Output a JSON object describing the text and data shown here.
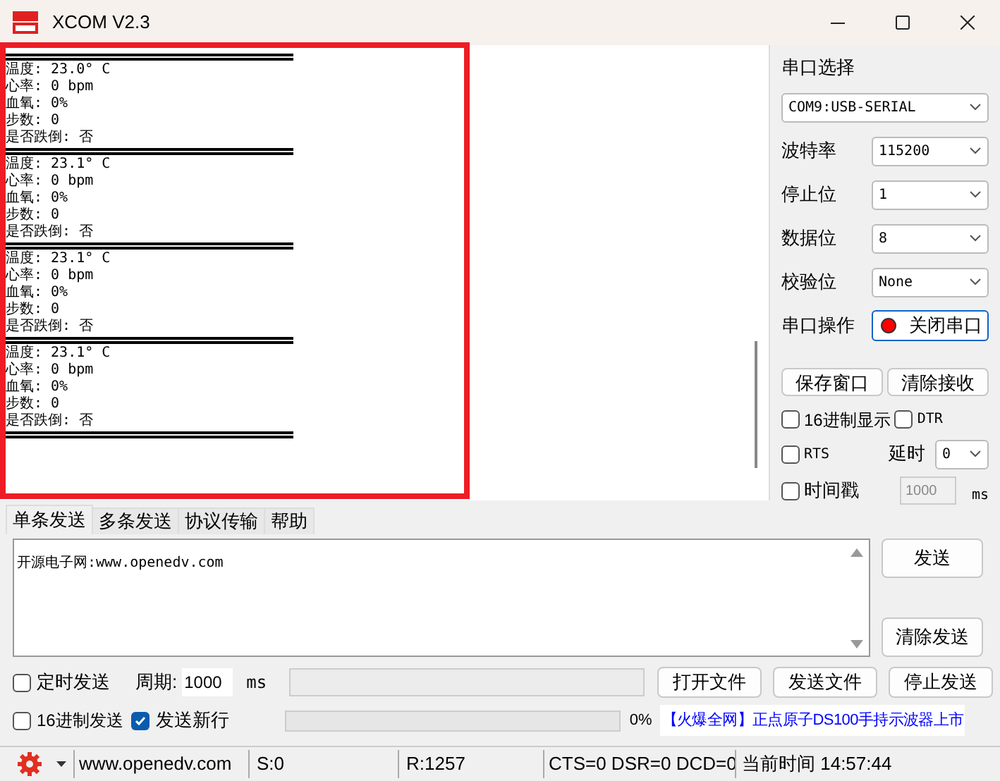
{
  "window": {
    "title": "XCOM V2.3"
  },
  "receive": {
    "records": [
      {
        "lines": [
          "温度: 23.0° C",
          "心率: 0 bpm",
          "血氧: 0%",
          "步数: 0",
          "是否跌倒: 否"
        ]
      },
      {
        "lines": [
          "温度: 23.1° C",
          "心率: 0 bpm",
          "血氧: 0%",
          "步数: 0",
          "是否跌倒: 否"
        ]
      },
      {
        "lines": [
          "温度: 23.1° C",
          "心率: 0 bpm",
          "血氧: 0%",
          "步数: 0",
          "是否跌倒: 否"
        ]
      },
      {
        "lines": [
          "温度: 23.1° C",
          "心率: 0 bpm",
          "血氧: 0%",
          "步数: 0",
          "是否跌倒: 否"
        ]
      }
    ]
  },
  "port_panel": {
    "title": "串口选择",
    "port": "COM9:USB-SERIAL",
    "settings": [
      {
        "label": "波特率",
        "value": "115200"
      },
      {
        "label": "停止位",
        "value": "1"
      },
      {
        "label": "数据位",
        "value": "8"
      },
      {
        "label": "校验位",
        "value": "None"
      }
    ],
    "operation": {
      "label": "串口操作",
      "button": "关闭串口",
      "open": true
    },
    "buttons": [
      "保存窗口",
      "清除接收"
    ],
    "hex_display": {
      "label": "16进制显示",
      "checked": false
    },
    "dtr": {
      "label": "DTR",
      "checked": false
    },
    "rts": {
      "label": "RTS",
      "checked": false
    },
    "delay": {
      "label": "延时",
      "value": "0"
    },
    "timestamp": {
      "label": "时间戳",
      "checked": false,
      "value": "1000",
      "unit": "ms"
    }
  },
  "tabs": [
    {
      "label": "单条发送",
      "selected": true
    },
    {
      "label": "多条发送",
      "selected": false
    },
    {
      "label": "协议传输",
      "selected": false
    },
    {
      "label": "帮助",
      "selected": false
    }
  ],
  "send_box": {
    "value": "开源电子网:www.openedv.com"
  },
  "send_buttons": [
    "发送",
    "清除发送"
  ],
  "timed_send": {
    "label": "定时发送",
    "checked": false,
    "period_label": "周期:",
    "period": "1000",
    "unit": "ms"
  },
  "file_buttons": [
    "打开文件",
    "发送文件",
    "停止发送"
  ],
  "hex_send": {
    "label": "16进制发送",
    "checked": false
  },
  "send_newline": {
    "label": "发送新行",
    "checked": true
  },
  "progress": {
    "level": 0,
    "reading": "0%"
  },
  "banner": "【火爆全网】正点原子DS100手持示波器上市",
  "status_bar": {
    "website": "www.openedv.com",
    "sent": "S:0",
    "received": "R:1257",
    "lines": "CTS=0 DSR=0 DCD=0",
    "time": "当前时间 14:57:44"
  }
}
